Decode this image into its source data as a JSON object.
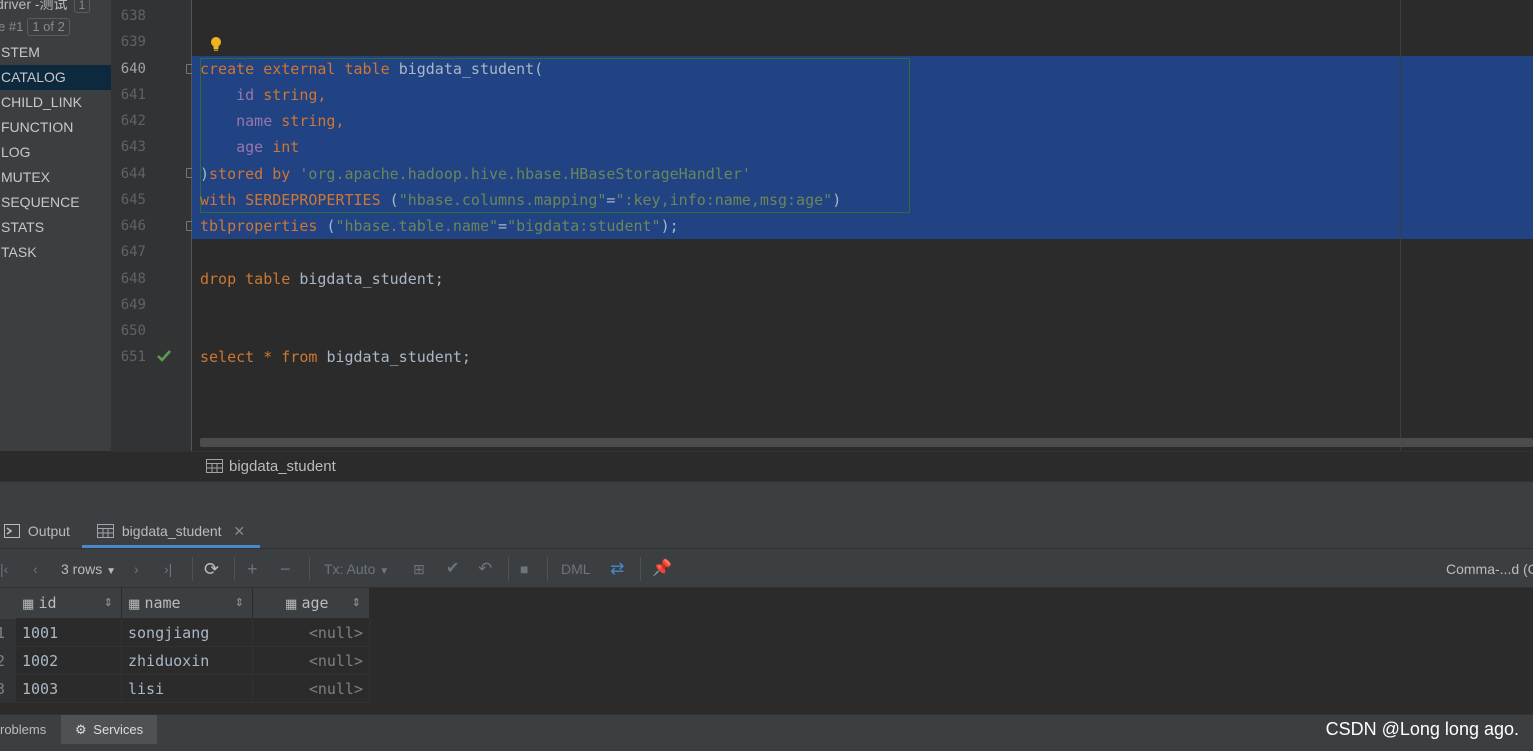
{
  "navigator": {
    "title": "driver -测试",
    "title_count": "1",
    "page_label": "e #1",
    "page_indicator": "1 of 2",
    "items": [
      {
        "label": "STEM"
      },
      {
        "label": "CATALOG"
      },
      {
        "label": "CHILD_LINK"
      },
      {
        "label": "FUNCTION"
      },
      {
        "label": "LOG"
      },
      {
        "label": "MUTEX"
      },
      {
        "label": "SEQUENCE"
      },
      {
        "label": "STATS"
      },
      {
        "label": "TASK"
      }
    ]
  },
  "editor": {
    "line_numbers": [
      "638",
      "639",
      "640",
      "641",
      "642",
      "643",
      "644",
      "645",
      "646",
      "647",
      "648",
      "649",
      "650",
      "651"
    ],
    "current_line": "640",
    "sql": {
      "l640": [
        "create",
        "external",
        "table",
        "bigdata_student("
      ],
      "l641": [
        "id",
        "string,"
      ],
      "l642": [
        "name",
        "string,"
      ],
      "l643": [
        "age",
        "int"
      ],
      "l644": [
        ")",
        "stored by",
        "'org.apache.hadoop.hive.hbase.HBaseStorageHandler'"
      ],
      "l645": [
        "with",
        "SERDEPROPERTIES",
        "(",
        "\"hbase.columns.mapping\"",
        "=",
        "\":key,info:name,msg:age\"",
        ")"
      ],
      "l646": [
        "tblproperties",
        "(",
        "\"hbase.table.name\"",
        "=",
        "\"bigdata:student\"",
        ");"
      ],
      "l648": [
        "drop",
        "table",
        "bigdata_student;"
      ],
      "l651": [
        "select",
        "*",
        "from",
        "bigdata_student;"
      ]
    }
  },
  "breadcrumb": {
    "label": "bigdata_student"
  },
  "tool_window": {
    "tabs": [
      {
        "label": "Output"
      },
      {
        "label": "bigdata_student"
      }
    ],
    "toolbar": {
      "rows_label": "3 rows",
      "tx_label": "Tx: Auto",
      "dml_label": "DML",
      "right_label": "Comma-...d (C"
    }
  },
  "grid": {
    "columns": [
      "id",
      "name",
      "age"
    ],
    "rows": [
      {
        "num": "1",
        "id": "1001",
        "name": "songjiang",
        "age": "<null>"
      },
      {
        "num": "2",
        "id": "1002",
        "name": "zhiduoxin",
        "age": "<null>"
      },
      {
        "num": "3",
        "id": "1003",
        "name": "lisi",
        "age": "<null>"
      }
    ]
  },
  "bottom_tabs": [
    {
      "label": "roblems"
    },
    {
      "label": "Services"
    }
  ],
  "watermark": "CSDN @Long long ago.",
  "colors": {
    "selection": "#214283",
    "keyword": "#cc7832",
    "string": "#6a8759",
    "column": "#9876aa",
    "accent": "#4a88c7"
  }
}
